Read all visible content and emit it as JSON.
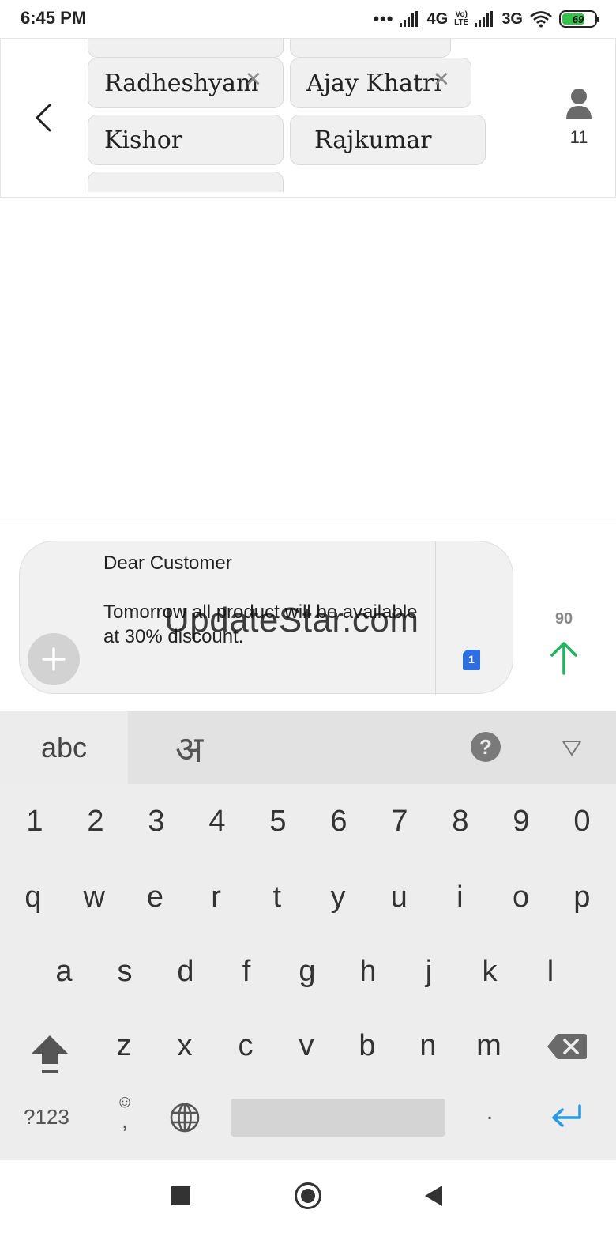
{
  "status_bar": {
    "time": "6:45 PM",
    "dots": "•••",
    "network_1": "4G",
    "volte_1": "Vo)",
    "volte_2": "LTE",
    "network_2": "3G",
    "battery_level": "69"
  },
  "header": {
    "recipients": [
      {
        "name": "Radheshyam",
        "removable": true
      },
      {
        "name": "Ajay Khatri",
        "removable": true
      },
      {
        "name": "Kishor",
        "removable": false
      },
      {
        "name": "Rajkumar",
        "removable": false
      }
    ],
    "recipient_count": "11"
  },
  "compose": {
    "message": "Dear Customer\n\nTomorrow all product will be available at 30% discount.",
    "sim_slot": "1",
    "char_remaining": "90",
    "watermark": "UpdateStar.com"
  },
  "keyboard": {
    "tab_abc": "abc",
    "tab_hindi": "अ",
    "help": "?",
    "row_numbers": [
      "1",
      "2",
      "3",
      "4",
      "5",
      "6",
      "7",
      "8",
      "9",
      "0"
    ],
    "row_1": [
      "q",
      "w",
      "e",
      "r",
      "t",
      "y",
      "u",
      "i",
      "o",
      "p"
    ],
    "row_2": [
      "a",
      "s",
      "d",
      "f",
      "g",
      "h",
      "j",
      "k",
      "l"
    ],
    "row_3": [
      "z",
      "x",
      "c",
      "v",
      "b",
      "n",
      "m"
    ],
    "symbols": "?123",
    "emoji_face": "☺",
    "comma": ",",
    "period": "."
  },
  "colors": {
    "send_accent": "#22b35e",
    "enter_accent": "#2a9be0",
    "sim_badge": "#2d6fe0"
  }
}
